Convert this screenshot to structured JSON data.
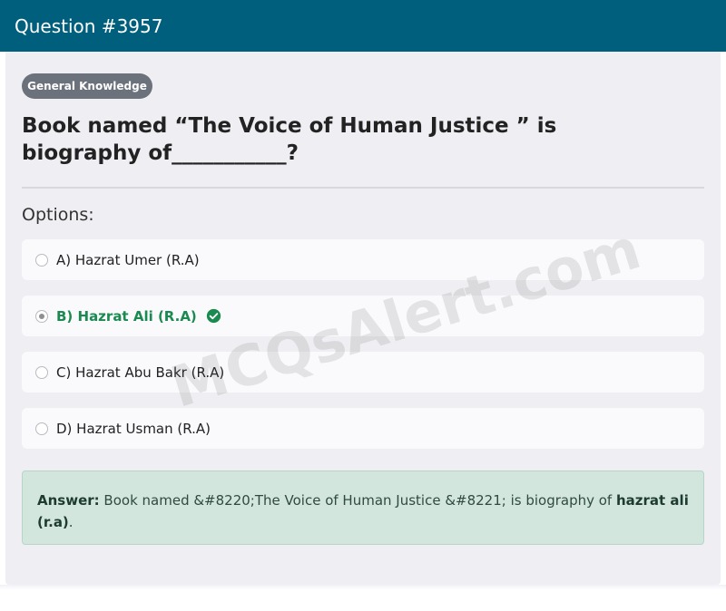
{
  "header": {
    "title": "Question #3957"
  },
  "badge": {
    "label": "General Knowledge"
  },
  "question": {
    "text": "Book named “The Voice of Human Justice ” is biography of___________?"
  },
  "options_label": "Options:",
  "options": [
    {
      "label": "A) Hazrat Umer (R.A)",
      "selected": false,
      "correct": false
    },
    {
      "label": "B) Hazrat Ali (R.A)",
      "selected": true,
      "correct": true
    },
    {
      "label": "C) Hazrat Abu Bakr (R.A)",
      "selected": false,
      "correct": false
    },
    {
      "label": "D) Hazrat Usman (R.A)",
      "selected": false,
      "correct": false
    }
  ],
  "answer": {
    "prefix": "Answer:",
    "body": " Book named &#8220;The Voice of Human Justice &#8221; is biography of ",
    "highlight": "hazrat ali (r.a)",
    "suffix": "."
  },
  "watermark": "MCQsAlert.com",
  "colors": {
    "header_bg": "#005f7c",
    "badge_bg": "#6c727c",
    "correct": "#1b8a50",
    "answer_bg": "#d3e6de"
  },
  "icons": {
    "correct": "check-circle-icon"
  }
}
